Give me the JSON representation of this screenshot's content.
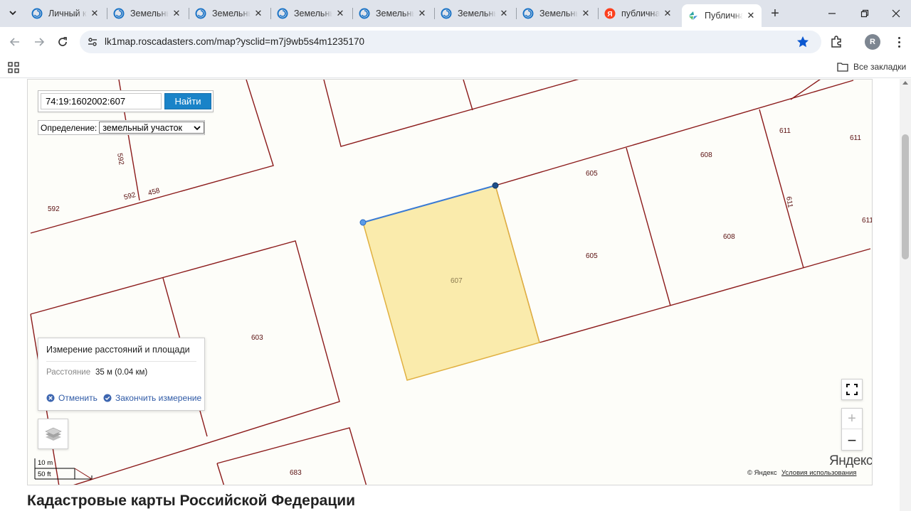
{
  "browser": {
    "tabs": [
      {
        "title": "Личный кабинет",
        "favicon": "rosreestr-icon",
        "active": false
      },
      {
        "title": "Земельный участок",
        "favicon": "roscadaster-icon",
        "active": false
      },
      {
        "title": "Земельный участок",
        "favicon": "roscadaster-icon",
        "active": false
      },
      {
        "title": "Земельный участок",
        "favicon": "roscadaster-icon",
        "active": false
      },
      {
        "title": "Земельный участок",
        "favicon": "roscadaster-icon",
        "active": false
      },
      {
        "title": "Земельный участок",
        "favicon": "roscadaster-icon",
        "active": false
      },
      {
        "title": "Земельный участок",
        "favicon": "roscadaster-icon",
        "active": false
      },
      {
        "title": "публичная кадастровая карта",
        "favicon": "yandex-icon",
        "active": false
      },
      {
        "title": "Публичная кадастровая карта",
        "favicon": "pkk-icon",
        "active": true
      }
    ],
    "url": "lk1map.roscadasters.com/map?ysclid=m7j9wb5s4m1235170",
    "profile_initial": "R",
    "bookmarks_all": "Все закладки"
  },
  "search": {
    "value": "74:19:1602002:607",
    "button": "Найти"
  },
  "definition": {
    "label": "Определение:",
    "selected": "земельный участок"
  },
  "measurement": {
    "title": "Измерение расстояний и площади",
    "distance_label": "Расстояние",
    "distance_value": "35 м (0.04 км)",
    "cancel": "Отменить",
    "finish": "Закончить измерение"
  },
  "map": {
    "parcel_labels": [
      {
        "text": "592",
        "rot": 80
      },
      {
        "text": "592",
        "rot": -15
      },
      {
        "text": "458",
        "rot": -15
      },
      {
        "text": "592",
        "rot": 0
      },
      {
        "text": "605",
        "rot": 0
      },
      {
        "text": "605",
        "rot": 0
      },
      {
        "text": "608",
        "rot": 0
      },
      {
        "text": "608",
        "rot": 0
      },
      {
        "text": "611",
        "rot": 0
      },
      {
        "text": "611",
        "rot": 0
      },
      {
        "text": "611",
        "rot": 80
      },
      {
        "text": "611",
        "rot": 0
      },
      {
        "text": "607",
        "rot": 0
      },
      {
        "text": "603",
        "rot": 0
      },
      {
        "text": "683",
        "rot": 0
      }
    ],
    "scale_m": "10 m",
    "scale_ft": "50 ft",
    "logo": "Яндекс",
    "copyright": "© Яндекс",
    "terms": "Условия использования",
    "colors": {
      "boundary": "#8b1a1a",
      "selected_fill": "#f9e79f",
      "selected_stroke": "#e0b040",
      "measure_line": "#3a7bd5"
    }
  },
  "page": {
    "heading": "Кадастровые карты Российской Федерации"
  }
}
